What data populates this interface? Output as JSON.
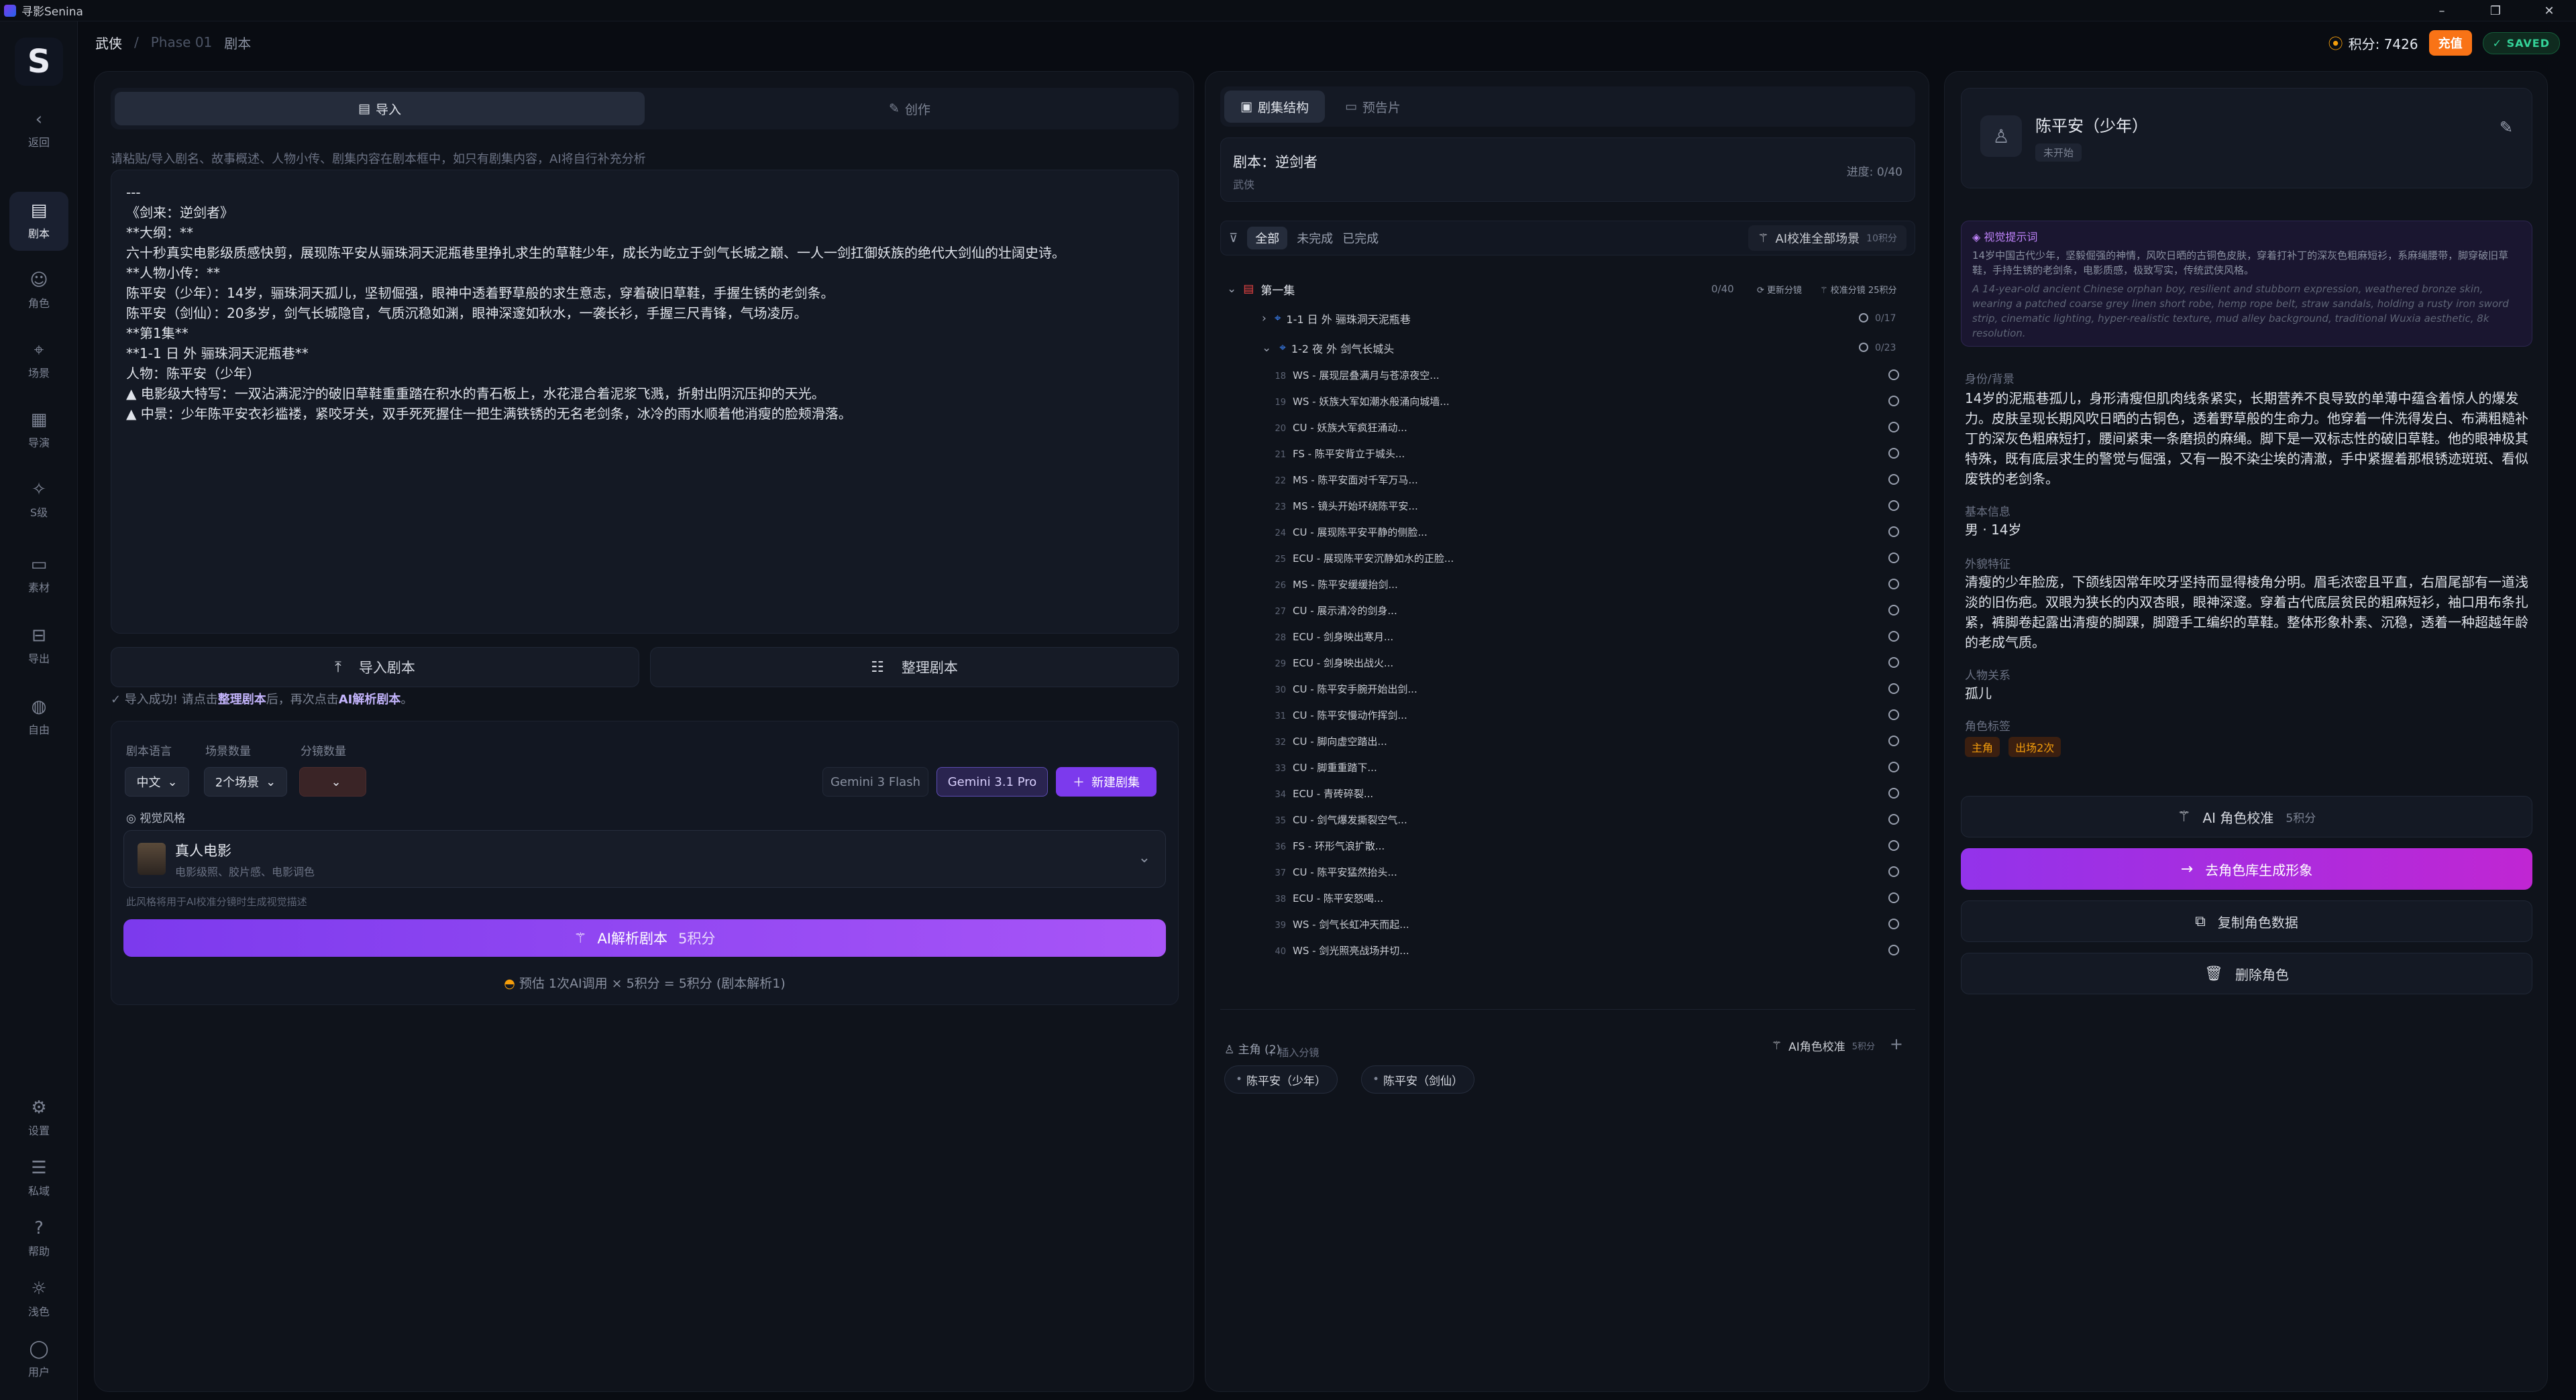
{
  "app": {
    "title": "寻影Senina"
  },
  "sidebar": {
    "back": "返回",
    "items": [
      {
        "label": "剧本",
        "icon": "document-icon"
      },
      {
        "label": "角色",
        "icon": "users-icon"
      },
      {
        "label": "场景",
        "icon": "map-pin-icon"
      },
      {
        "label": "导演",
        "icon": "clapperboard-icon"
      },
      {
        "label": "S级",
        "icon": "sparkle-icon"
      },
      {
        "label": "素材",
        "icon": "video-icon"
      },
      {
        "label": "导出",
        "icon": "export-icon"
      },
      {
        "label": "自由",
        "icon": "palette-icon"
      }
    ],
    "bottom": [
      {
        "label": "设置",
        "icon": "gear-icon"
      },
      {
        "label": "私域",
        "icon": "database-icon"
      },
      {
        "label": "帮助",
        "icon": "help-icon"
      },
      {
        "label": "浅色",
        "icon": "sun-icon"
      },
      {
        "label": "用户",
        "icon": "user-icon"
      }
    ]
  },
  "breadcrumb": {
    "project": "武侠",
    "sep": "/",
    "phase": "Phase 01",
    "page": "剧本"
  },
  "header": {
    "credits": "积分: 7426",
    "recharge": "充值",
    "saved": "✓ SAVED"
  },
  "left": {
    "tabs": [
      "导入",
      "创作"
    ],
    "hint": "请粘贴/导入剧名、故事概述、人物小传、剧集内容在剧本框中，如只有剧集内容，AI将自行补充分析",
    "script_lines": [
      "---",
      "《剑来：逆剑者》",
      "",
      "**大纲：**",
      "六十秒真实电影级质感快剪，展现陈平安从骊珠洞天泥瓶巷里挣扎求生的草鞋少年，成长为屹立于剑气长城之巅、一人一剑扛御妖族的绝代大剑仙的壮阔史诗。",
      "",
      "**人物小传：**",
      "陈平安（少年）：14岁，骊珠洞天孤儿，坚韧倔强，眼神中透着野草般的求生意志，穿着破旧草鞋，手握生锈的老剑条。",
      "陈平安（剑仙）：20多岁，剑气长城隐官，气质沉稳如渊，眼神深邃如秋水，一袭长衫，手握三尺青锋，气场凌厉。",
      "",
      "**第1集**",
      "",
      "**1-1 日 外 骊珠洞天泥瓶巷**",
      "人物：陈平安（少年）",
      "",
      "▲ 电影级大特写：一双沾满泥泞的破旧草鞋重重踏在积水的青石板上，水花混合着泥浆飞溅，折射出阴沉压抑的天光。",
      "",
      "▲ 中景：少年陈平安衣衫褴褛，紧咬牙关，双手死死握住一把生满铁锈的无名老剑条，冰冷的雨水顺着他消瘦的脸颊滑落。"
    ],
    "import_btn": "导入剧本",
    "organize_btn": "整理剧本",
    "success_pre": "✓ 导入成功! 请点击",
    "success_b1": "整理剧本",
    "success_mid": "后，再次点击",
    "success_b2": "AI解析剧本",
    "success_post": "。",
    "config": {
      "lang_label": "剧本语言",
      "lang": "中文",
      "scene_label": "场景数量",
      "scene": "2个场景",
      "shot_label": "分镜数量",
      "shot": "",
      "model_a": "Gemini 3 Flash",
      "model_b": "Gemini 3.1 Pro",
      "new_ep": "新建剧集",
      "style_label": "视觉风格",
      "style_name": "真人电影",
      "style_desc": "电影级照、胶片感、电影调色",
      "style_note": "此风格将用于AI校准分镜时生成视觉描述",
      "parse_btn": "AI解析剧本",
      "parse_cost": "5积分",
      "estimate": "预估 1次AI调用 × 5积分 = 5积分 (剧本解析1)"
    }
  },
  "middle": {
    "tabs": [
      "剧集结构",
      "预告片"
    ],
    "script_title": "剧本：逆剑者",
    "script_genre": "武侠",
    "progress": "进度: 0/40",
    "filters": [
      "全部",
      "未完成",
      "已完成"
    ],
    "calibrate_all": "AI校准全部场景",
    "calibrate_all_cost": "10积分",
    "episode": "第一集",
    "episode_count": "0/40",
    "update_shots": "更新分镜",
    "calibrate_shots": "校准分镜 25积分",
    "scenes": [
      {
        "label": "1-1 日 外 骊珠洞天泥瓶巷",
        "count": "0/17"
      },
      {
        "label": "1-2 夜 外 剑气长城头",
        "count": "0/23"
      }
    ],
    "shots": [
      {
        "n": "18",
        "t": "WS - 展现层叠满月与苍凉夜空..."
      },
      {
        "n": "19",
        "t": "WS - 妖族大军如潮水般涌向城墙..."
      },
      {
        "n": "20",
        "t": "CU - 妖族大军疯狂涌动..."
      },
      {
        "n": "21",
        "t": "FS - 陈平安背立于城头..."
      },
      {
        "n": "22",
        "t": "MS - 陈平安面对千军万马..."
      },
      {
        "n": "23",
        "t": "MS - 镜头开始环绕陈平安..."
      },
      {
        "n": "24",
        "t": "CU - 展现陈平安平静的侧脸..."
      },
      {
        "n": "25",
        "t": "ECU - 展现陈平安沉静如水的正脸..."
      },
      {
        "n": "26",
        "t": "MS - 陈平安缓缓抬剑..."
      },
      {
        "n": "27",
        "t": "CU - 展示清冷的剑身..."
      },
      {
        "n": "28",
        "t": "ECU - 剑身映出寒月..."
      },
      {
        "n": "29",
        "t": "ECU - 剑身映出战火..."
      },
      {
        "n": "30",
        "t": "CU - 陈平安手腕开始出剑..."
      },
      {
        "n": "31",
        "t": "CU - 陈平安慢动作挥剑..."
      },
      {
        "n": "32",
        "t": "CU - 脚向虚空踏出..."
      },
      {
        "n": "33",
        "t": "CU - 脚重重踏下..."
      },
      {
        "n": "34",
        "t": "ECU - 青砖碎裂..."
      },
      {
        "n": "35",
        "t": "CU - 剑气爆发撕裂空气..."
      },
      {
        "n": "36",
        "t": "FS - 环形气浪扩散..."
      },
      {
        "n": "37",
        "t": "CU - 陈平安猛然抬头..."
      },
      {
        "n": "38",
        "t": "ECU - 陈平安怒喝..."
      },
      {
        "n": "39",
        "t": "WS - 剑气长虹冲天而起..."
      },
      {
        "n": "40",
        "t": "WS - 剑光照亮战场并切..."
      }
    ],
    "insert_shot": "+ 插入分镜",
    "cast_label": "主角 (2)",
    "cast_calibrate": "AI角色校准",
    "cast_cost": "5积分",
    "cast": [
      "陈平安（少年）",
      "陈平安（剑仙）"
    ]
  },
  "right": {
    "name": "陈平安（少年）",
    "status": "未开始",
    "visual_label": "视觉提示词",
    "visual_zh": "14岁中国古代少年，坚毅倔强的神情，风吹日晒的古铜色皮肤，穿着打补丁的深灰色粗麻短衫，系麻绳腰带，脚穿破旧草鞋，手持生锈的老剑条，电影质感，极致写实，传统武侠风格。",
    "visual_en": "A 14-year-old ancient Chinese orphan boy, resilient and stubborn expression, weathered bronze skin, wearing a patched coarse grey linen short robe, hemp rope belt, straw sandals, holding a rusty iron sword strip, cinematic lighting, hyper-realistic texture, mud alley background, traditional Wuxia aesthetic, 8k resolution.",
    "bg_label": "身份/背景",
    "bg_text": "14岁的泥瓶巷孤儿，身形清瘦但肌肉线条紧实，长期营养不良导致的单薄中蕴含着惊人的爆发力。皮肤呈现长期风吹日晒的古铜色，透着野草般的生命力。他穿着一件洗得发白、布满粗糙补丁的深灰色粗麻短打，腰间紧束一条磨损的麻绳。脚下是一双标志性的破旧草鞋。他的眼神极其特殊，既有底层求生的警觉与倔强，又有一股不染尘埃的清澈，手中紧握着那根锈迹斑斑、看似废铁的老剑条。",
    "basic_label": "基本信息",
    "basic_text": "男 · 14岁",
    "look_label": "外貌特征",
    "look_text": "清瘦的少年脸庞，下颌线因常年咬牙坚持而显得棱角分明。眉毛浓密且平直，右眉尾部有一道浅淡的旧伤疤。双眼为狭长的内双杏眼，眼神深邃。穿着古代底层贫民的粗麻短衫，袖口用布条扎紧，裤脚卷起露出清瘦的脚踝，脚蹬手工编织的草鞋。整体形象朴素、沉稳，透着一种超越年龄的老成气质。",
    "rel_label": "人物关系",
    "rel_text": "孤儿",
    "tags_label": "角色标签",
    "tags": [
      "主角",
      "出场2次"
    ],
    "btn_calibrate": "AI 角色校准",
    "btn_calibrate_cost": "5积分",
    "btn_gen": "去角色库生成形象",
    "btn_copy": "复制角色数据",
    "btn_delete": "删除角色"
  }
}
